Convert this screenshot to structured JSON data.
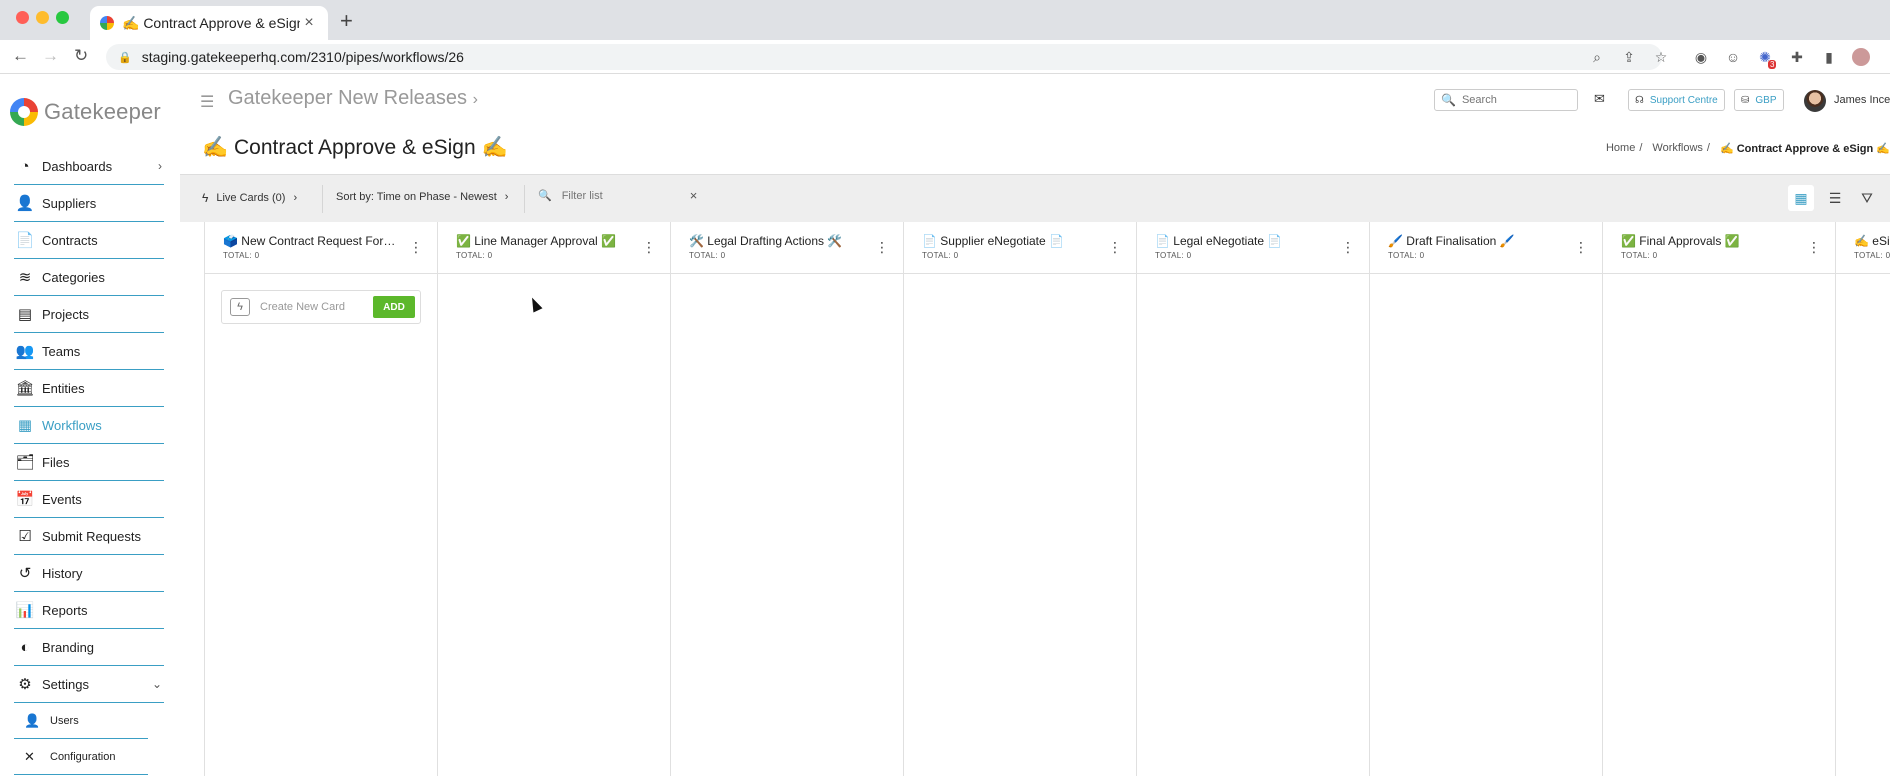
{
  "browser": {
    "tab_title": "✍️ Contract Approve & eSign ✍️",
    "url": "staging.gatekeeperhq.com/2310/pipes/workflows/26",
    "notification_count": "3"
  },
  "sidebar": {
    "logo_text": "Gatekeeper",
    "items": [
      {
        "label": "Dashboards",
        "icon": "gauge-icon",
        "glyph": "◔",
        "chevron": "›"
      },
      {
        "label": "Suppliers",
        "icon": "user-tie-icon",
        "glyph": "👤"
      },
      {
        "label": "Contracts",
        "icon": "document-icon",
        "glyph": "📄"
      },
      {
        "label": "Categories",
        "icon": "layers-icon",
        "glyph": "≋"
      },
      {
        "label": "Projects",
        "icon": "projects-icon",
        "glyph": "▤"
      },
      {
        "label": "Teams",
        "icon": "users-icon",
        "glyph": "👥"
      },
      {
        "label": "Entities",
        "icon": "bank-icon",
        "glyph": "🏛"
      },
      {
        "label": "Workflows",
        "icon": "grid-icon",
        "glyph": "▦"
      },
      {
        "label": "Files",
        "icon": "files-icon",
        "glyph": "🗂"
      },
      {
        "label": "Events",
        "icon": "calendar-icon",
        "glyph": "📅"
      },
      {
        "label": "Submit Requests",
        "icon": "checklist-icon",
        "glyph": "☑"
      },
      {
        "label": "History",
        "icon": "history-icon",
        "glyph": "↺"
      },
      {
        "label": "Reports",
        "icon": "bar-chart-icon",
        "glyph": "📊"
      },
      {
        "label": "Branding",
        "icon": "palette-icon",
        "glyph": "◐"
      },
      {
        "label": "Settings",
        "icon": "gear-icon",
        "glyph": "⚙",
        "chevron": "⌄"
      }
    ],
    "sub_items": [
      {
        "label": "Users",
        "icon": "user-icon",
        "glyph": "👤"
      },
      {
        "label": "Configuration",
        "icon": "tools-icon",
        "glyph": "✕"
      }
    ]
  },
  "header": {
    "workspace": "Gatekeeper New Releases",
    "workspace_chevron": "›",
    "search_placeholder": "Search",
    "support": "Support Centre",
    "currency": "GBP",
    "user_name": "James Ince"
  },
  "page": {
    "title": "✍️ Contract Approve & eSign ✍️",
    "breadcrumb": {
      "home": "Home",
      "sep": "/",
      "workflows": "Workflows",
      "current": "✍️ Contract Approve & eSign ✍️"
    }
  },
  "filterbar": {
    "live_cards": "Live Cards (0)",
    "sort": "Sort by: Time on Phase - Newest",
    "filter_placeholder": "Filter list",
    "clear": "×",
    "chevron": "›"
  },
  "board": {
    "create_placeholder": "Create New Card",
    "add_label": "ADD",
    "columns": [
      {
        "title": "🗳️ New Contract Request Form ...",
        "total": "TOTAL: 0"
      },
      {
        "title": "✅ Line Manager Approval ✅",
        "total": "TOTAL: 0"
      },
      {
        "title": "🛠️ Legal Drafting Actions 🛠️",
        "total": "TOTAL: 0"
      },
      {
        "title": "📄 Supplier eNegotiate 📄",
        "total": "TOTAL: 0"
      },
      {
        "title": "📄 Legal eNegotiate 📄",
        "total": "TOTAL: 0"
      },
      {
        "title": "🖌️ Draft Finalisation 🖌️",
        "total": "TOTAL: 0"
      },
      {
        "title": "✅ Final Approvals ✅",
        "total": "TOTAL: 0"
      },
      {
        "title": "✍️ eSign",
        "total": "TOTAL: 0"
      }
    ]
  },
  "colors": {
    "accent": "#3a9ec4",
    "add_button": "#5cb82b"
  }
}
